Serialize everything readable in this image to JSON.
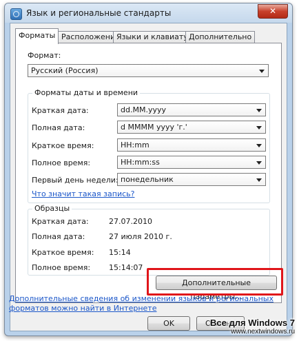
{
  "window": {
    "title": "Язык и региональные стандарты",
    "close_glyph": "✕"
  },
  "tabs": [
    "Форматы",
    "Расположение",
    "Языки и клавиатуры",
    "Дополнительно"
  ],
  "format": {
    "label": "Формат:",
    "value": "Русский (Россия)"
  },
  "date_time_group": {
    "title": "Форматы даты и времени",
    "rows": [
      {
        "label": "Краткая дата:",
        "value": "dd.MM.yyyy"
      },
      {
        "label": "Полная дата:",
        "value": "d MMMM yyyy 'г.'"
      },
      {
        "label": "Краткое время:",
        "value": "HH:mm"
      },
      {
        "label": "Полное время:",
        "value": "HH:mm:ss"
      },
      {
        "label": "Первый день недели:",
        "value": "понедельник"
      }
    ],
    "link": "Что значит такая запись?"
  },
  "samples": {
    "title": "Образцы",
    "rows": [
      {
        "label": "Краткая дата:",
        "value": "27.07.2010"
      },
      {
        "label": "Полная дата:",
        "value": "27 июля 2010 г."
      },
      {
        "label": "Краткое время:",
        "value": "15:14"
      },
      {
        "label": "Полное время:",
        "value": "15:14:07"
      }
    ]
  },
  "additional_button": "Дополнительные параметры...",
  "bottom_link_line1": "Дополнительные сведения об изменении языков и региональных",
  "bottom_link_line2": "форматов можно найти в Интернете",
  "buttons": {
    "ok": "OK",
    "cancel": "Отмена"
  },
  "watermark": {
    "title": "Все для Windows 7",
    "url": "www.nextwindows.ru"
  },
  "colors": {
    "highlight": "#e0151a",
    "link": "#1a56c9"
  }
}
